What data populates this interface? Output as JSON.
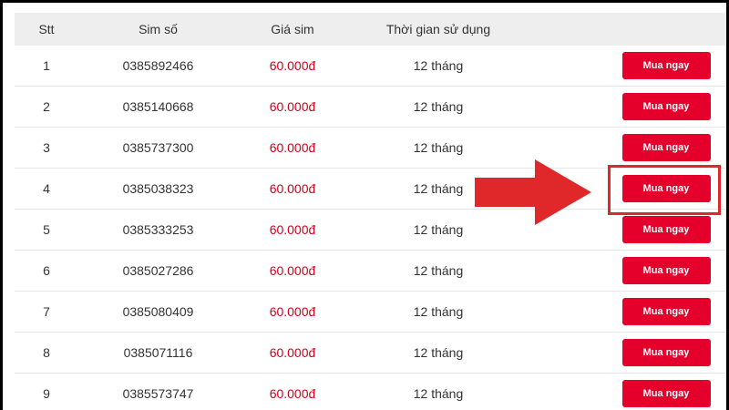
{
  "table": {
    "headers": {
      "stt": "Stt",
      "sim": "Sim số",
      "price": "Giá sim",
      "duration": "Thời gian sử dụng"
    },
    "rows": [
      {
        "stt": "1",
        "sim": "0385892466",
        "price": "60.000đ",
        "duration": "12 tháng",
        "action": "Mua ngay"
      },
      {
        "stt": "2",
        "sim": "0385140668",
        "price": "60.000đ",
        "duration": "12 tháng",
        "action": "Mua ngay"
      },
      {
        "stt": "3",
        "sim": "0385737300",
        "price": "60.000đ",
        "duration": "12 tháng",
        "action": "Mua ngay"
      },
      {
        "stt": "4",
        "sim": "0385038323",
        "price": "60.000đ",
        "duration": "12 tháng",
        "action": "Mua ngay"
      },
      {
        "stt": "5",
        "sim": "0385333253",
        "price": "60.000đ",
        "duration": "12 tháng",
        "action": "Mua ngay"
      },
      {
        "stt": "6",
        "sim": "0385027286",
        "price": "60.000đ",
        "duration": "12 tháng",
        "action": "Mua ngay"
      },
      {
        "stt": "7",
        "sim": "0385080409",
        "price": "60.000đ",
        "duration": "12 tháng",
        "action": "Mua ngay"
      },
      {
        "stt": "8",
        "sim": "0385071116",
        "price": "60.000đ",
        "duration": "12 tháng",
        "action": "Mua ngay"
      },
      {
        "stt": "9",
        "sim": "0385573747",
        "price": "60.000đ",
        "duration": "12 tháng",
        "action": "Mua ngay"
      }
    ]
  },
  "annotation": {
    "arrow_icon": "right-arrow-icon",
    "highlighted_row": 4,
    "color": "#e0282b"
  },
  "colors": {
    "button": "#e5002b",
    "price": "#d0021b",
    "header_bg": "#eeeeee"
  }
}
